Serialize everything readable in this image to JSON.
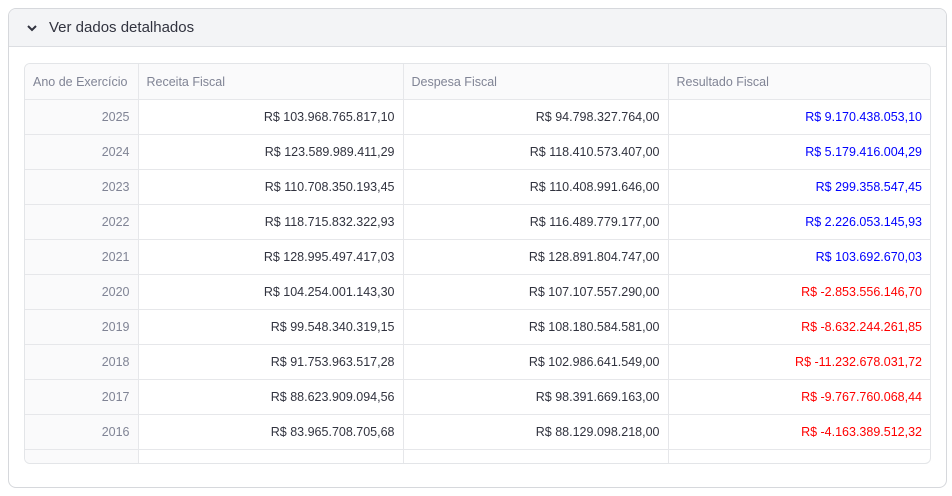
{
  "expander": {
    "title": "Ver dados detalhados",
    "icon": "chevron-down-icon",
    "expanded": true
  },
  "table": {
    "columns": [
      "Ano de Exercício",
      "Receita Fiscal",
      "Despesa Fiscal",
      "Resultado Fiscal"
    ],
    "colors": {
      "positive": "#0000ff",
      "negative": "#ff0000"
    },
    "rows": [
      {
        "year": "2025",
        "receita": "R$ 103.968.765.817,10",
        "despesa": "R$ 94.798.327.764,00",
        "resultado": "R$ 9.170.438.053,10",
        "sign": "pos"
      },
      {
        "year": "2024",
        "receita": "R$ 123.589.989.411,29",
        "despesa": "R$ 118.410.573.407,00",
        "resultado": "R$ 5.179.416.004,29",
        "sign": "pos"
      },
      {
        "year": "2023",
        "receita": "R$ 110.708.350.193,45",
        "despesa": "R$ 110.408.991.646,00",
        "resultado": "R$ 299.358.547,45",
        "sign": "pos"
      },
      {
        "year": "2022",
        "receita": "R$ 118.715.832.322,93",
        "despesa": "R$ 116.489.779.177,00",
        "resultado": "R$ 2.226.053.145,93",
        "sign": "pos"
      },
      {
        "year": "2021",
        "receita": "R$ 128.995.497.417,03",
        "despesa": "R$ 128.891.804.747,00",
        "resultado": "R$ 103.692.670,03",
        "sign": "pos"
      },
      {
        "year": "2020",
        "receita": "R$ 104.254.001.143,30",
        "despesa": "R$ 107.107.557.290,00",
        "resultado": "R$ -2.853.556.146,70",
        "sign": "neg"
      },
      {
        "year": "2019",
        "receita": "R$ 99.548.340.319,15",
        "despesa": "R$ 108.180.584.581,00",
        "resultado": "R$ -8.632.244.261,85",
        "sign": "neg"
      },
      {
        "year": "2018",
        "receita": "R$ 91.753.963.517,28",
        "despesa": "R$ 102.986.641.549,00",
        "resultado": "R$ -11.232.678.031,72",
        "sign": "neg"
      },
      {
        "year": "2017",
        "receita": "R$ 88.623.909.094,56",
        "despesa": "R$ 98.391.669.163,00",
        "resultado": "R$ -9.767.760.068,44",
        "sign": "neg"
      },
      {
        "year": "2016",
        "receita": "R$ 83.965.708.705,68",
        "despesa": "R$ 88.129.098.218,00",
        "resultado": "R$ -4.163.389.512,32",
        "sign": "neg"
      }
    ]
  }
}
